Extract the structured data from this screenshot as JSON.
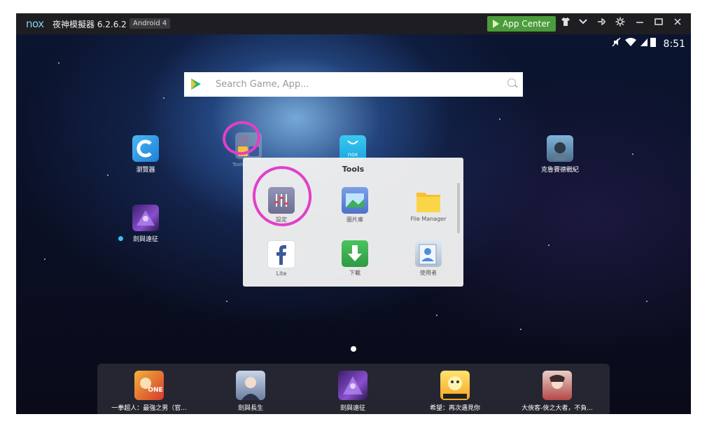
{
  "titlebar": {
    "logo": "nox",
    "title": "夜神模擬器 6.2.6.2",
    "android_badge": "Android 4",
    "app_center": "App Center",
    "icons": [
      "shirt-icon",
      "chevron-down-icon",
      "pin-icon",
      "gear-icon",
      "minimize-icon",
      "maximize-icon",
      "close-icon"
    ]
  },
  "status_bar": {
    "time": "8:51",
    "icons": [
      "mute-icon",
      "wifi-icon",
      "signal-icon",
      "battery-icon"
    ]
  },
  "search": {
    "placeholder": "Search Game, App..."
  },
  "desktop_apps": [
    {
      "name": "瀏覽器",
      "icon": "browser-icon"
    },
    {
      "name": "Tools",
      "icon": "tools-folder-icon"
    },
    {
      "name": "",
      "icon": "nox-store-icon"
    },
    {
      "name": "克魯賽德戰紀",
      "icon": "game-icon"
    },
    {
      "name": "劍與遠征",
      "icon": "game-icon"
    }
  ],
  "folder": {
    "title": "Tools",
    "items": [
      {
        "label": "設定",
        "icon": "settings-icon"
      },
      {
        "label": "圖片庫",
        "icon": "gallery-icon"
      },
      {
        "label": "File Manager",
        "icon": "folder-icon"
      },
      {
        "label": "Lite",
        "icon": "facebook-icon"
      },
      {
        "label": "下載",
        "icon": "download-icon"
      },
      {
        "label": "使用者",
        "icon": "contacts-icon"
      }
    ]
  },
  "dock": {
    "apps": [
      {
        "label": "一拳超人：最強之男（官...",
        "icon": "onepunch-icon"
      },
      {
        "label": "劍與長生",
        "icon": "game-icon"
      },
      {
        "label": "劍與遠征",
        "icon": "game-icon"
      },
      {
        "label": "希望：再次遇見你",
        "icon": "seal-mobile-icon"
      },
      {
        "label": "大俠客-俠之大者，不負...",
        "icon": "game-icon"
      }
    ]
  },
  "colors": {
    "app_center": "#4b9c3b",
    "annotation": "#e23fc9",
    "titlebar": "#1e1e22"
  }
}
